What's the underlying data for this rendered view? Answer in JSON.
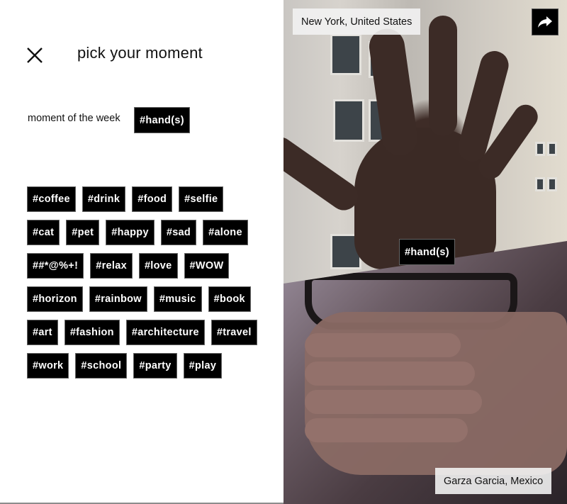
{
  "header": {
    "title": "pick your moment",
    "close_icon": "close-icon"
  },
  "moment_of_week": {
    "label": "moment of the week",
    "tag": "#hand(s)"
  },
  "tags": [
    [
      "#coffee",
      "#drink",
      "#food",
      "#selfie"
    ],
    [
      "#cat",
      "#pet",
      "#happy",
      "#sad",
      "#alone"
    ],
    [
      "##*@%+!",
      "#relax",
      "#love",
      "#WOW"
    ],
    [
      "#horizon",
      "#rainbow",
      "#music",
      "#book"
    ],
    [
      "#art",
      "#fashion",
      "#architecture",
      "#travel"
    ],
    [
      "#work",
      "#school",
      "#party",
      "#play"
    ]
  ],
  "photos": {
    "top_location": "New York, United States",
    "bottom_location": "Garza Garcia, Mexico",
    "tag": "#hand(s)",
    "share_icon": "share-arrow-icon"
  },
  "colors": {
    "tag_bg": "#000000",
    "tag_text": "#ffffff",
    "label_bg": "#f2f2f2"
  }
}
